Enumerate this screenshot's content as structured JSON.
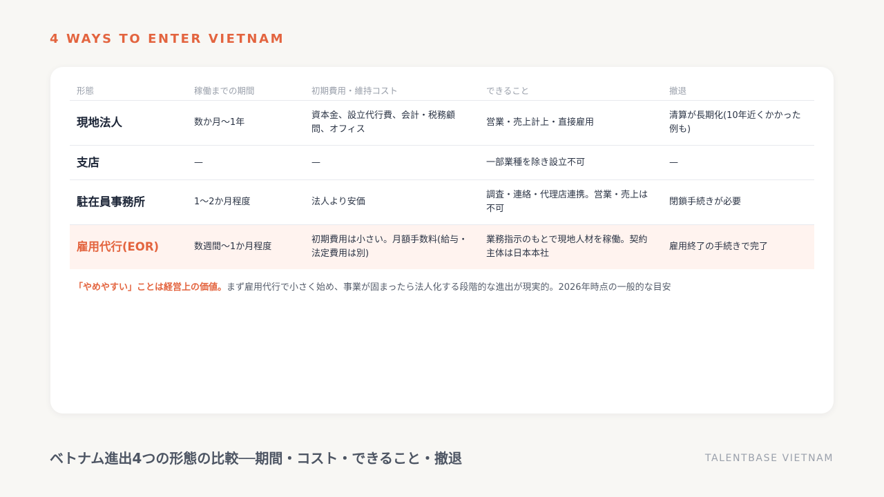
{
  "kicker": "4 WAYS TO ENTER VIETNAM",
  "table": {
    "headers": [
      "形態",
      "稼働までの期間",
      "初期費用・維持コスト",
      "できること",
      "撤退"
    ],
    "rows": [
      [
        "現地法人",
        "数か月〜1年",
        "資本金、設立代行費、会計・税務顧問、オフィス",
        "営業・売上計上・直接雇用",
        "清算が長期化(10年近くかかった例も)"
      ],
      [
        "支店",
        "—",
        "—",
        "一部業種を除き設立不可",
        "—"
      ],
      [
        "駐在員事務所",
        "1〜2か月程度",
        "法人より安価",
        "調査・連絡・代理店連携。営業・売上は不可",
        "閉鎖手続きが必要"
      ],
      [
        "雇用代行(EOR)",
        "数週間〜1か月程度",
        "初期費用は小さい。月額手数料(給与・法定費用は別)",
        "業務指示のもとで現地人材を稼働。契約主体は日本本社",
        "雇用終了の手続きで完了"
      ]
    ]
  },
  "note": {
    "highlight": "「やめやすい」ことは経営上の価値。",
    "text": "まず雇用代行で小さく始め、事業が固まったら法人化する段階的な進出が現実的。2026年時点の一般的な目安"
  },
  "footer": {
    "title": "ベトナム進出4つの形態の比較──期間・コスト・できること・撤退",
    "brand": "TALENTBASE VIETNAM"
  },
  "colors": {
    "accent": "#e3643f",
    "highlight_row": "#fff3ef",
    "background": "#f8f7f4"
  }
}
